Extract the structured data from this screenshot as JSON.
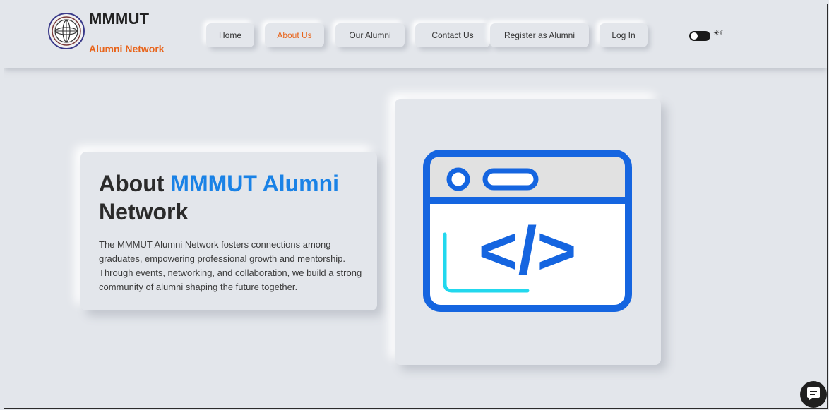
{
  "brand": {
    "title": "MMMUT",
    "subtitle": "Alumni Network"
  },
  "nav": {
    "items": [
      {
        "label": "Home"
      },
      {
        "label": "About Us",
        "active": true
      },
      {
        "label": "Our Alumni"
      },
      {
        "label": "Contact Us"
      },
      {
        "label": "Register as Alumni"
      },
      {
        "label": "Log In"
      }
    ]
  },
  "theme_toggle": {
    "icons": "☀☾",
    "state": "off"
  },
  "about": {
    "title_prefix": "About",
    "title_highlight": "MMMUT Alumni",
    "title_suffix": "Network",
    "body": "The MMMUT Alumni Network fosters connections among graduates, empowering professional growth and mentorship. Through events, networking, and collaboration, we build a strong community of alumni shaping the future together."
  },
  "illustration": {
    "icon": "code-window-icon",
    "code_text": "</>"
  },
  "chat": {
    "icon": "chat-icon"
  },
  "colors": {
    "background": "#e3e6eb",
    "accent_orange": "#e8641b",
    "accent_blue": "#1a82e6",
    "illustration_blue": "#1565e0",
    "illustration_cyan": "#22d8ee"
  }
}
